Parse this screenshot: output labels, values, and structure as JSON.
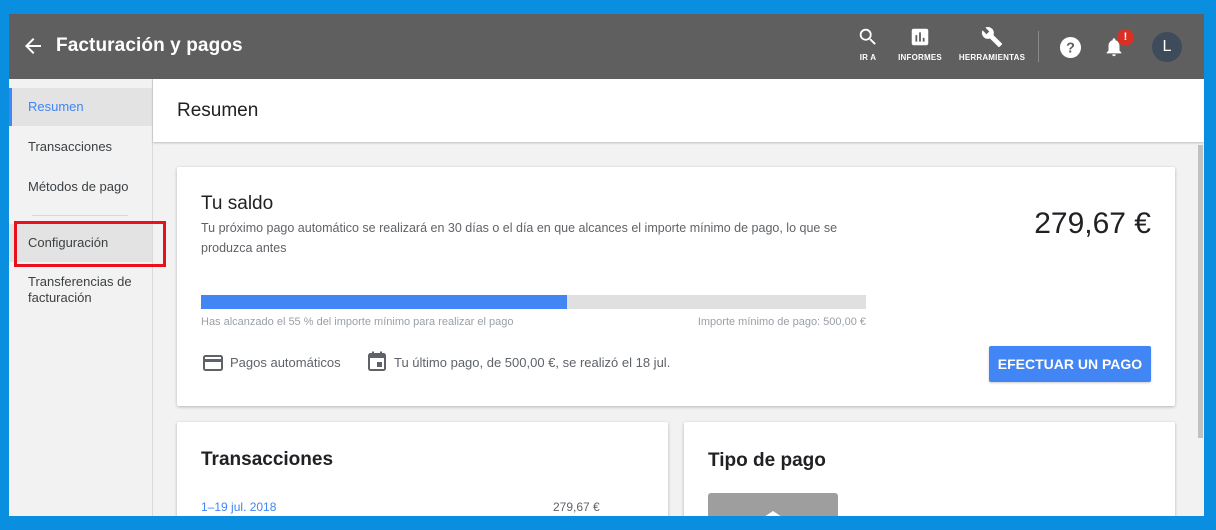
{
  "colors": {
    "accent": "#4285f4",
    "topbar": "#5f5f5f",
    "highlight": "#e8101a",
    "outer_background": "#0a8ee0"
  },
  "header": {
    "title": "Facturación y pagos",
    "back_icon": "arrow-back-icon",
    "actions": [
      {
        "icon": "search-icon",
        "label": "IR A"
      },
      {
        "icon": "chart-icon",
        "label": "INFORMES"
      },
      {
        "icon": "wrench-icon",
        "label": "HERRAMIENTAS"
      }
    ],
    "help_icon": "help-icon",
    "notifications": {
      "icon": "bell-icon",
      "badge": "!"
    },
    "avatar": "L"
  },
  "sidebar": {
    "items": [
      {
        "label": "Resumen",
        "active": true
      },
      {
        "label": "Transacciones"
      },
      {
        "label": "Métodos de pago"
      },
      {
        "label": "Configuración",
        "highlighted": true
      },
      {
        "label": "Transferencias de facturación"
      }
    ]
  },
  "main": {
    "page_title": "Resumen",
    "saldo": {
      "title": "Tu saldo",
      "description": "Tu próximo pago automático se realizará en 30 días o el día en que alcances el importe mínimo de pago, lo que se produzca antes",
      "amount": "279,67 €",
      "progress_fraction": 0.55,
      "progress_left": "Has alcanzado el 55 % del importe mínimo para realizar el pago",
      "progress_right": "Importe mínimo de pago: 500,00 €",
      "auto_payments": "Pagos automáticos",
      "last_payment": "Tu último pago, de 500,00 €, se realizó el 18 jul.",
      "pay_button": "EFECTUAR UN PAGO"
    },
    "transacciones": {
      "title": "Transacciones",
      "rows": [
        {
          "period": "1–19 jul. 2018",
          "amount": "279,67 €"
        }
      ]
    },
    "tipo_pago": {
      "title": "Tipo de pago"
    }
  }
}
